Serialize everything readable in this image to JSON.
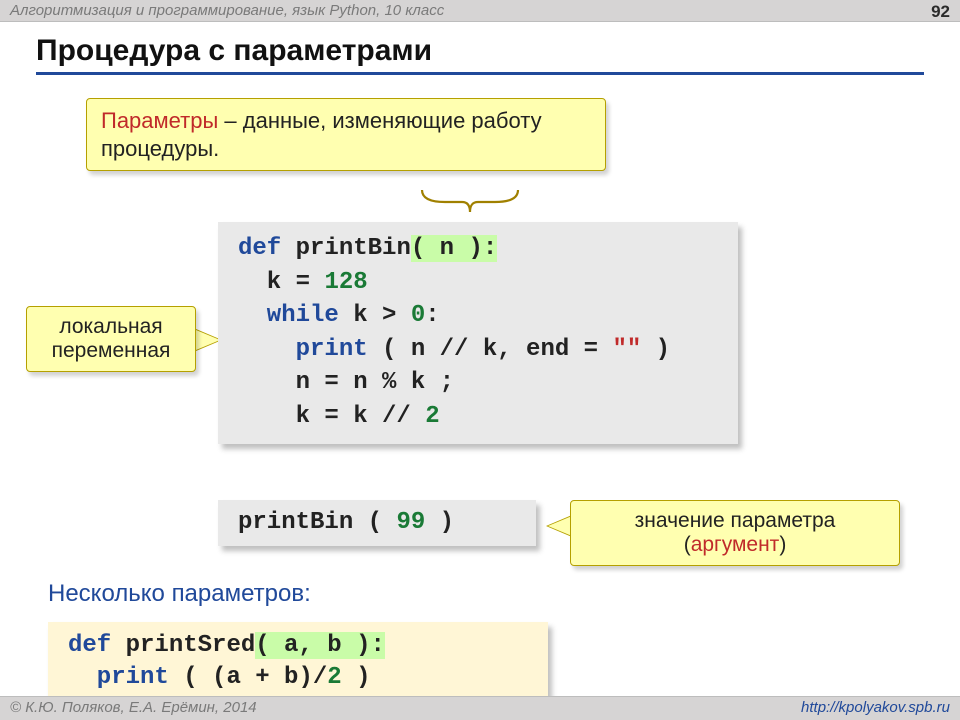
{
  "topbar": {
    "breadcrumb": "Алгоритмизация и программирование, язык Python, 10 класс",
    "page": "92"
  },
  "title": "Процедура с параметрами",
  "callouts": {
    "params_hl": "Параметры",
    "params_rest": " – данные, изменяющие работу процедуры.",
    "local_l1": "локальная",
    "local_l2": "переменная",
    "arg_l1": "значение параметра",
    "arg_hl": "аргумент",
    "arg_open": "(",
    "arg_close": ")"
  },
  "code": {
    "main": {
      "kw_def": "def",
      "name": " printBin",
      "sig": "( n ):",
      "l2_a": "  k",
      "l2_b": " = ",
      "l2_c": "128",
      "l3_kw": "  while",
      "l3_rest": " k > ",
      "l3_zero": "0",
      "l3_colon": ":",
      "l4_kw": "    print",
      "l4_rest": " ( n // k, end = ",
      "l4_str": "\"\"",
      "l4_end": " )",
      "l5": "    n = n % k ;",
      "l6_a": "    k = k // ",
      "l6_b": "2"
    },
    "call": {
      "name": "printBin ( ",
      "arg": "99",
      "end": " )"
    },
    "multi": {
      "kw_def": "def",
      "name": " printSred",
      "sig": "( a, b ):",
      "l2_kw": "  print",
      "l2_rest": " ( (a + b)/",
      "l2_two": "2",
      "l2_end": " )"
    }
  },
  "subhead": "Несколько параметров:",
  "footer": {
    "copyright": "© К.Ю. Поляков, Е.А. Ерёмин, 2014",
    "url": "http://kpolyakov.spb.ru"
  }
}
